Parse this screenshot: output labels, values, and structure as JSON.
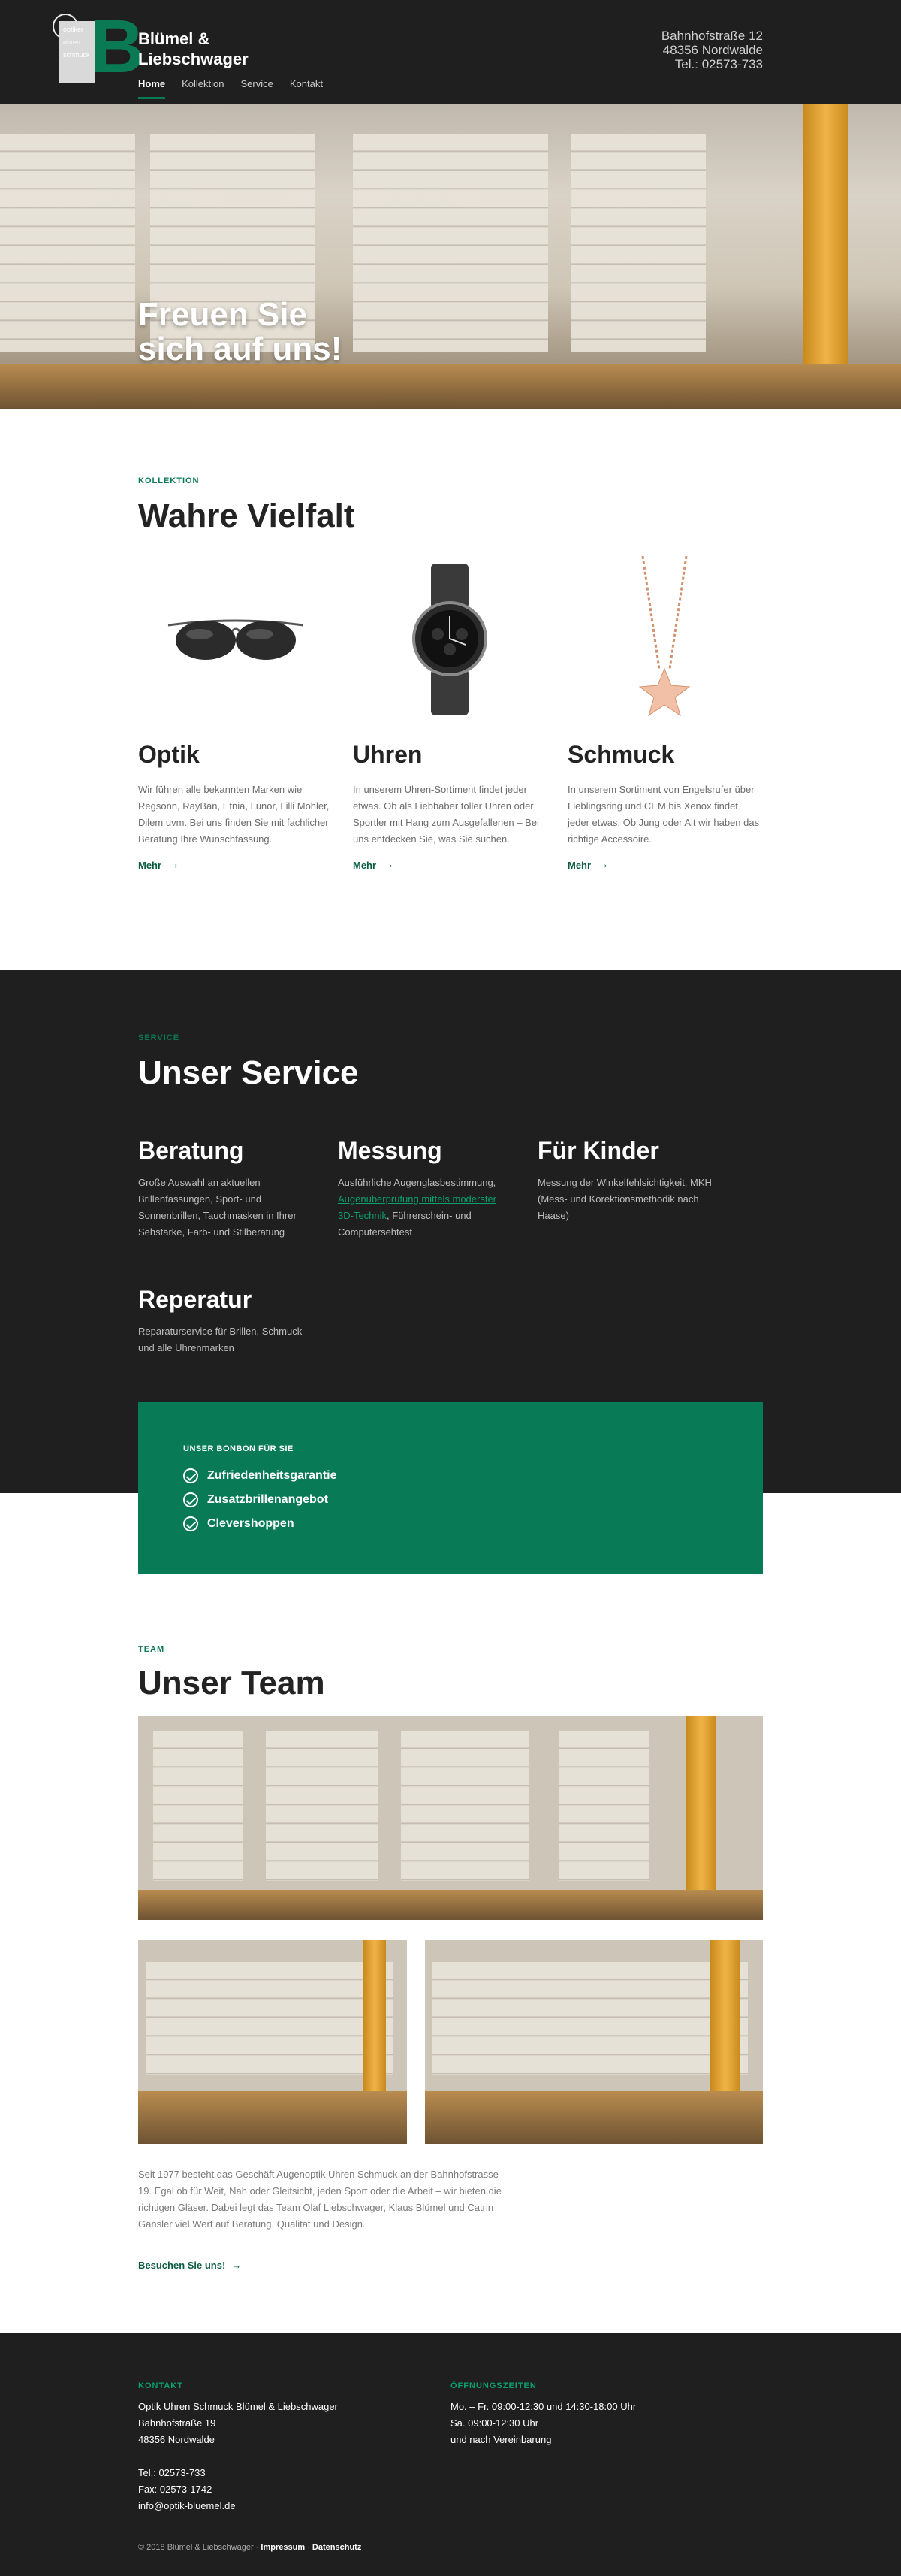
{
  "header": {
    "logo_text": [
      "optiker",
      "uhren",
      "schmuck"
    ],
    "logo_letter": "B",
    "brand_line1": "Blümel &",
    "brand_line2": "Liebschwager",
    "address_line1": "Bahnhofstraße 12",
    "address_line2": "48356 Nordwalde",
    "address_line3": "Tel.: 02573-733",
    "nav": [
      "Home",
      "Kollektion",
      "Service",
      "Kontakt"
    ],
    "accent_color": "#0a7a55"
  },
  "hero": {
    "title_line1": "Freuen Sie",
    "title_line2": "sich auf uns!"
  },
  "kollektion": {
    "eyebrow": "KOLLEKTION",
    "title": "Wahre Vielfalt",
    "items": [
      {
        "title": "Optik",
        "text": "Wir führen alle bekannten Marken wie Regsonn, RayBan, Etnia, Lunor, Lilli Mohler, Dilem uvm. Bei uns finden Sie mit fachlicher Beratung Ihre Wunschfassung.",
        "link": "Mehr"
      },
      {
        "title": "Uhren",
        "text": "In unserem Uhren-Sortiment findet jeder etwas. Ob als Liebhaber toller Uhren oder Sportler mit Hang zum Ausgefallenen – Bei uns entdecken Sie, was Sie suchen.",
        "link": "Mehr"
      },
      {
        "title": "Schmuck",
        "text": "In unserem Sortiment von Engelsrufer über Lieblingsring und CEM bis Xenox findet jeder etwas. Ob Jung oder Alt wir haben das richtige Accessoire.",
        "link": "Mehr"
      }
    ]
  },
  "service": {
    "eyebrow": "SERVICE",
    "title": "Unser Service",
    "items": [
      {
        "title": "Beratung",
        "text": "Große Auswahl an aktuellen Brillenfassungen, Sport- und Sonnenbrillen, Tauchmasken in Ihrer Sehstärke, Farb- und Stilberatung"
      },
      {
        "title": "Messung",
        "text_before": "Ausführliche Augenglasbestimmung,",
        "text_link": "Augenüberprüfung mittels moderster 3D-Technik",
        "text_after": ", Führerschein- und Computersehtest"
      },
      {
        "title": "Für Kinder",
        "text": "Messung der Winkelfehlsichtigkeit, MKH (Mess- und Korektionsmethodik nach Haase)"
      },
      {
        "title": "Reperatur",
        "text": "Reparaturservice für Brillen, Schmuck und alle Uhrenmarken"
      }
    ],
    "bonbon": {
      "title": "UNSER BONBON FÜR SIE",
      "items": [
        "Zufriedenheitsgarantie",
        "Zusatzbrillenangebot",
        "Clevershoppen"
      ]
    }
  },
  "team": {
    "eyebrow": "TEAM",
    "title": "Unser Team",
    "text": "Seit 1977 besteht das Geschäft Augenoptik Uhren Schmuck an der Bahnhofstrasse 19. Egal ob für Weit, Nah oder Gleitsicht, jeden Sport oder die Arbeit – wir bieten die richtigen Gläser. Dabei legt das Team Olaf Liebschwager, Klaus Blümel und Catrin Gänsler viel Wert auf Beratung, Qualität und Design.",
    "link": "Besuchen Sie uns!"
  },
  "footer": {
    "contact_label": "KONTAKT",
    "contact_lines": [
      "Optik Uhren Schmuck Blümel & Liebschwager",
      "Bahnhofstraße 19",
      "48356 Nordwalde"
    ],
    "contact_lines2": [
      "Tel.: 02573-733",
      "Fax: 02573-1742",
      "info@optik-bluemel.de"
    ],
    "hours_label": "ÖFFNUNGSZEITEN",
    "hours_lines": [
      "Mo. – Fr. 09:00-12:30 und 14:30-18:00 Uhr",
      "Sa. 09:00-12:30 Uhr",
      "und nach Vereinbarung"
    ],
    "copyright": "© 2018 Blümel & Liebschwager ·",
    "impressum": "Impressum",
    "sep": "·",
    "datenschutz": "Datenschutz"
  }
}
